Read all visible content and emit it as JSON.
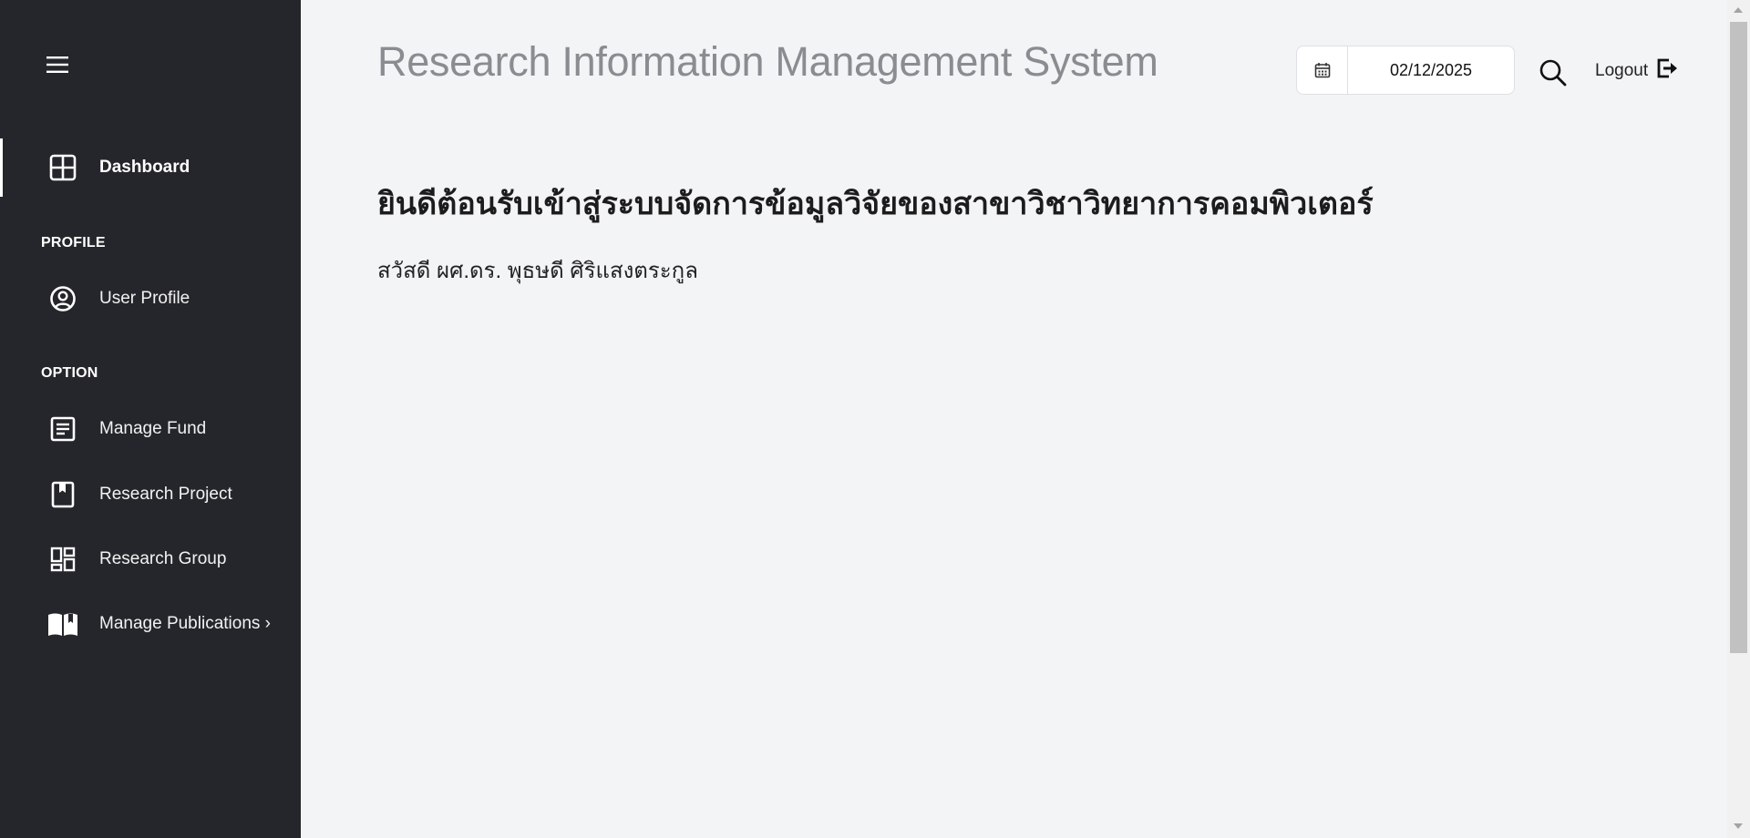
{
  "sidebar": {
    "menu_icon": "hamburger-menu-icon",
    "dashboard": {
      "label": "Dashboard",
      "icon": "dashboard-grid-icon",
      "active": true
    },
    "profile_section": {
      "title": "PROFILE"
    },
    "user_profile": {
      "label": "User Profile",
      "icon": "user-circle-icon"
    },
    "option_section": {
      "title": "OPTION"
    },
    "items": [
      {
        "label": "Manage Fund",
        "icon": "document-list-icon"
      },
      {
        "label": "Research Project",
        "icon": "bookmark-book-icon"
      },
      {
        "label": "Research Group",
        "icon": "group-grid-icon"
      },
      {
        "label": "Manage Publications ›",
        "icon": "open-book-icon"
      }
    ]
  },
  "header": {
    "title": "Research Information Management System",
    "date": {
      "value": "02/12/2025",
      "icon": "calendar-icon"
    },
    "search_icon": "search-icon",
    "logout": {
      "label": "Logout",
      "icon": "logout-icon"
    }
  },
  "main": {
    "welcome": "ยินดีต้อนรับเข้าสู่ระบบจัดการข้อมูลวิจัยของสาขาวิชาวิทยาการคอมพิวเตอร์",
    "greeting": "สวัสดี ผศ.ดร. พุธษดี ศิริแสงตระกูล"
  },
  "colors": {
    "sidebar_bg": "#25262b",
    "page_bg": "#f3f4f6",
    "title_text": "#8a8c91"
  }
}
